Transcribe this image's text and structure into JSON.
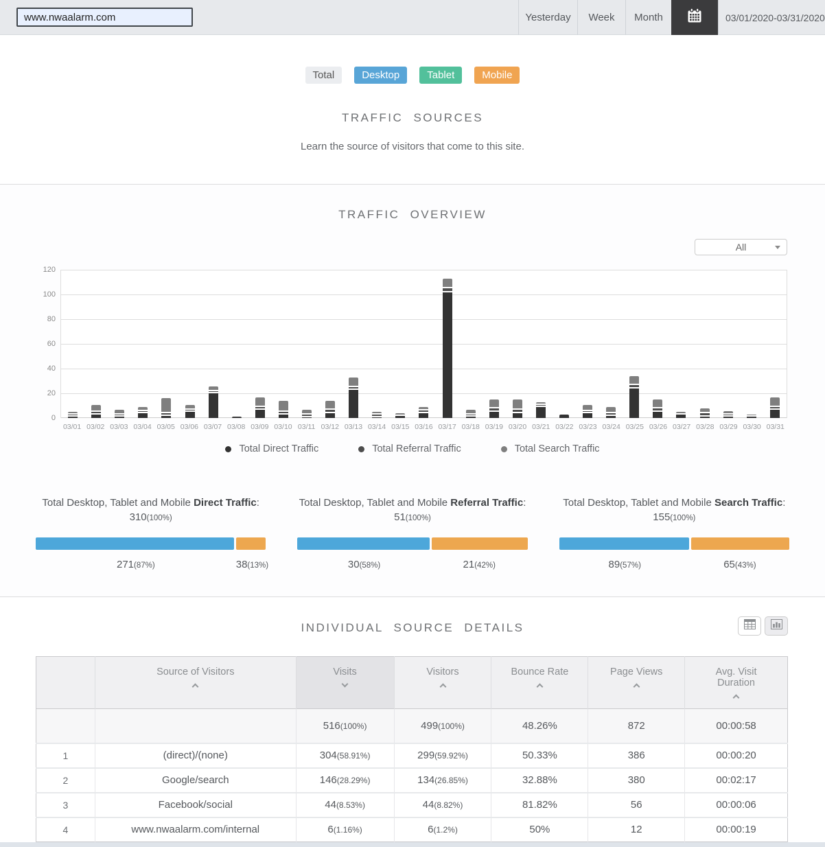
{
  "topbar": {
    "url_value": "www.nwaalarm.com",
    "yesterday_label": "Yesterday",
    "week_label": "Week",
    "month_label": "Month",
    "date_range": "03/01/2020-03/31/2020"
  },
  "filters": {
    "total": "Total",
    "desktop": "Desktop",
    "tablet": "Tablet",
    "mobile": "Mobile"
  },
  "sources_header": {
    "title": "TRAFFIC SOURCES",
    "subtitle": "Learn the source of visitors that come to this site."
  },
  "overview": {
    "title": "TRAFFIC OVERVIEW",
    "dropdown_value": "All"
  },
  "chart_data": {
    "type": "bar",
    "stacked": true,
    "title": "TRAFFIC OVERVIEW",
    "xlabel": "",
    "ylabel": "",
    "ylim": [
      0,
      120
    ],
    "yticks": [
      0,
      20,
      40,
      60,
      80,
      100,
      120
    ],
    "grid": true,
    "legend_position": "bottom",
    "categories": [
      "03/01",
      "03/02",
      "03/03",
      "03/04",
      "03/05",
      "03/06",
      "03/07",
      "03/08",
      "03/09",
      "03/10",
      "03/11",
      "03/12",
      "03/13",
      "03/14",
      "03/15",
      "03/16",
      "03/17",
      "03/18",
      "03/19",
      "03/20",
      "03/21",
      "03/22",
      "03/23",
      "03/24",
      "03/25",
      "03/26",
      "03/27",
      "03/28",
      "03/29",
      "03/30",
      "03/31"
    ],
    "series": [
      {
        "name": "Total Direct Traffic",
        "color": "#333333",
        "values": [
          2,
          4,
          2,
          5,
          3,
          6,
          21,
          2,
          8,
          4,
          1,
          5,
          24,
          1,
          3,
          5,
          103,
          2,
          6,
          5,
          10,
          4,
          5,
          3,
          25,
          6,
          4,
          2,
          2,
          2,
          8
        ]
      },
      {
        "name": "Total Referral Traffic",
        "color": "#4d4d4d",
        "values": [
          1,
          1,
          2,
          1,
          2,
          1,
          1,
          0,
          1,
          1,
          1,
          3,
          1,
          2,
          0,
          2,
          3,
          2,
          3,
          3,
          1,
          0,
          1,
          1,
          3,
          3,
          0,
          3,
          1,
          0,
          1
        ]
      },
      {
        "name": "Total Search Traffic",
        "color": "#7f7f7f",
        "values": [
          2,
          6,
          4,
          3,
          12,
          4,
          4,
          0,
          8,
          9,
          4,
          7,
          8,
          2,
          1,
          3,
          8,
          4,
          7,
          8,
          1,
          0,
          5,
          5,
          7,
          7,
          1,
          4,
          3,
          2,
          8
        ]
      }
    ]
  },
  "summaries": [
    {
      "prefix": "Total Desktop, Tablet and Mobile ",
      "bold": "Direct Traffic",
      "suffix": ":",
      "total": "310",
      "total_pct": "(100%)",
      "left_value": "271",
      "left_pct_label": "(87%)",
      "left_pct": 87,
      "right_value": "38",
      "right_pct_label": "(13%)",
      "right_pct": 13
    },
    {
      "prefix": "Total Desktop, Tablet and Mobile ",
      "bold": "Referral Traffic",
      "suffix": ":",
      "total": "51",
      "total_pct": "(100%)",
      "left_value": "30",
      "left_pct_label": "(58%)",
      "left_pct": 58,
      "right_value": "21",
      "right_pct_label": "(42%)",
      "right_pct": 42
    },
    {
      "prefix": "Total Desktop, Tablet and Mobile ",
      "bold": "Search Traffic",
      "suffix": ":",
      "total": "155",
      "total_pct": "(100%)",
      "left_value": "89",
      "left_pct_label": "(57%)",
      "left_pct": 57,
      "right_value": "65",
      "right_pct_label": "(43%)",
      "right_pct": 43
    }
  ],
  "details": {
    "title": "INDIVIDUAL SOURCE DETAILS"
  },
  "table": {
    "headers": [
      {
        "label": "",
        "sort": null
      },
      {
        "label": "Source of Visitors",
        "sort": "up"
      },
      {
        "label": "Visits",
        "sort": "down",
        "active": true
      },
      {
        "label": "Visitors",
        "sort": "up"
      },
      {
        "label": "Bounce Rate",
        "sort": "up"
      },
      {
        "label": "Page Views",
        "sort": "up"
      },
      {
        "label": "Avg. Visit Duration",
        "sort": "up",
        "wrap": true
      }
    ],
    "totals": [
      "",
      "",
      {
        "v": "516",
        "p": "(100%)"
      },
      {
        "v": "499",
        "p": "(100%)"
      },
      "48.26%",
      "872",
      "00:00:58"
    ],
    "rows": [
      [
        "1",
        "(direct)/(none)",
        {
          "v": "304",
          "p": "(58.91%)"
        },
        {
          "v": "299",
          "p": "(59.92%)"
        },
        "50.33%",
        "386",
        "00:00:20"
      ],
      [
        "2",
        "Google/search",
        {
          "v": "146",
          "p": "(28.29%)"
        },
        {
          "v": "134",
          "p": "(26.85%)"
        },
        "32.88%",
        "380",
        "00:02:17"
      ],
      [
        "3",
        "Facebook/social",
        {
          "v": "44",
          "p": "(8.53%)"
        },
        {
          "v": "44",
          "p": "(8.82%)"
        },
        "81.82%",
        "56",
        "00:00:06"
      ],
      [
        "4",
        "www.nwaalarm.com/internal",
        {
          "v": "6",
          "p": "(1.16%)"
        },
        {
          "v": "6",
          "p": "(1.2%)"
        },
        "50%",
        "12",
        "00:00:19"
      ]
    ]
  },
  "colors": {
    "accent_blue": "#4da7da",
    "accent_orange": "#eda74f",
    "desktop_blue": "#58a5d7",
    "tablet_green": "#52c09b",
    "mobile_orange": "#f0a451"
  }
}
